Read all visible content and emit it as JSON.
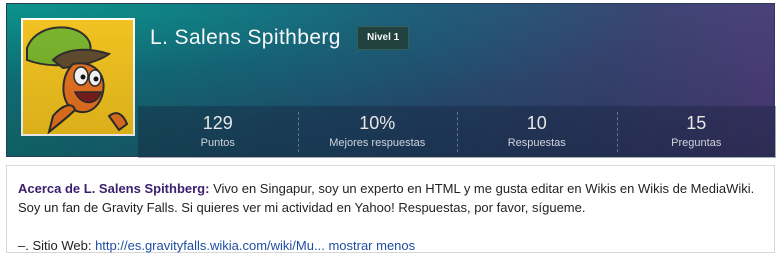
{
  "profile": {
    "name": "L. Salens Spithberg",
    "level": "Nivel 1",
    "avatar": "wander-cartoon-avatar"
  },
  "stats": [
    {
      "value": "129",
      "label": "Puntos"
    },
    {
      "value": "10%",
      "label": "Mejores respuestas"
    },
    {
      "value": "10",
      "label": "Respuestas"
    },
    {
      "value": "15",
      "label": "Preguntas"
    }
  ],
  "about": {
    "title": "Acerca de L. Salens Spithberg:",
    "text": " Vivo en Singapur, soy un experto en HTML y me gusta editar en Wikis en Wikis de MediaWiki. Soy un fan de Gravity Falls. Si quieres ver mi actividad en Yahoo! Respuestas, por favor, sígueme.",
    "site_prefix": "–. Sitio Web: ",
    "site_link": "http://es.gravityfalls.wikia.com/wiki/Mu...",
    "less_link": "mostrar menos"
  },
  "colors": {
    "header_start": "#0f6f72",
    "header_end": "#4a3a78",
    "about_title": "#3b1f6e",
    "link": "#1f4fa3"
  }
}
